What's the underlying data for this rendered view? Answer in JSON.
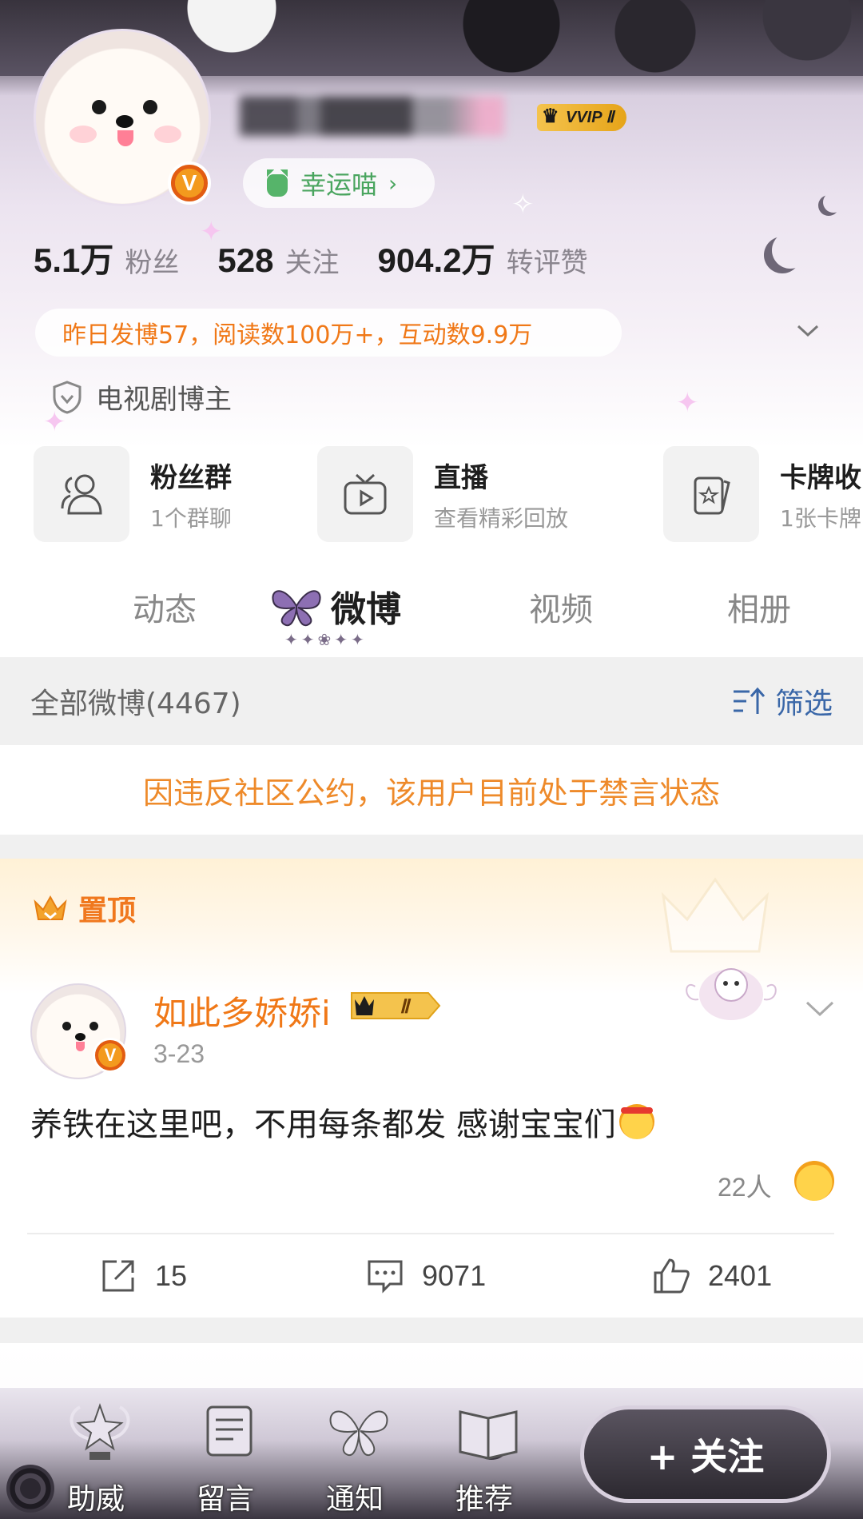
{
  "profile": {
    "vip_badge": "VVIP Ⅱ",
    "lucky_label": "幸运喵",
    "stats": [
      {
        "value": "5.1万",
        "label": "粉丝"
      },
      {
        "value": "528",
        "label": "关注"
      },
      {
        "value": "904.2万",
        "label": "转评赞"
      }
    ],
    "summary": "昨日发博57，阅读数100万+，互动数9.9万",
    "tag": "电视剧博主"
  },
  "shortcuts": [
    {
      "title": "粉丝群",
      "subtitle": "1个群聊",
      "icon": "group-icon"
    },
    {
      "title": "直播",
      "subtitle": "查看精彩回放",
      "icon": "tv-icon"
    },
    {
      "title": "卡牌收",
      "subtitle": "1张卡牌",
      "icon": "card-icon"
    }
  ],
  "tabs": [
    {
      "label": "动态"
    },
    {
      "label": "微博",
      "active": true
    },
    {
      "label": "视频"
    },
    {
      "label": "相册"
    }
  ],
  "list": {
    "title": "全部微博(4467)",
    "filter_label": "筛选",
    "notice": "因违反社区公约，该用户目前处于禁言状态"
  },
  "post": {
    "pinned_label": "置顶",
    "author": "如此多娇娇i",
    "member_level": "Ⅱ",
    "date": "3-23",
    "text": "养铁在这里吧，不用每条都发 感谢宝宝们",
    "reaction_count": "22人",
    "reposts": "15",
    "comments": "9071",
    "likes": "2401"
  },
  "bottom_bar": {
    "items": [
      {
        "label": "助威",
        "icon": "trophy-icon"
      },
      {
        "label": "留言",
        "icon": "scroll-icon"
      },
      {
        "label": "通知",
        "icon": "butterfly-bell-icon"
      },
      {
        "label": "推荐",
        "icon": "book-icon"
      }
    ],
    "follow_label": "+ 关注"
  },
  "colors": {
    "accent_orange": "#f07817",
    "link_blue": "#3a67a8",
    "lucky_green": "#4aa55f",
    "vip_gold": "#f4c34d"
  }
}
